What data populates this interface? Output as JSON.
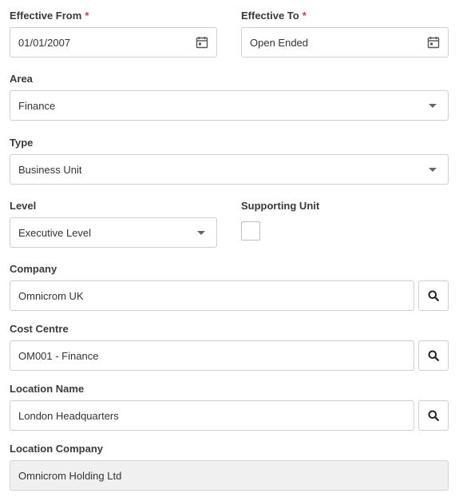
{
  "effective_from": {
    "label": "Effective From",
    "required_mark": "*",
    "value": "01/01/2007",
    "icon": "calendar-icon"
  },
  "effective_to": {
    "label": "Effective To",
    "required_mark": "*",
    "value": "Open Ended",
    "icon": "calendar-icon"
  },
  "area": {
    "label": "Area",
    "value": "Finance",
    "icon": "chevron-down-icon"
  },
  "type": {
    "label": "Type",
    "value": "Business Unit",
    "icon": "chevron-down-icon"
  },
  "level": {
    "label": "Level",
    "value": "Executive Level",
    "icon": "chevron-down-icon"
  },
  "supporting_unit": {
    "label": "Supporting Unit",
    "checked": false
  },
  "company": {
    "label": "Company",
    "value": "Omnicrom UK",
    "icon": "search-icon"
  },
  "cost_centre": {
    "label": "Cost Centre",
    "value": "OM001 - Finance",
    "icon": "search-icon"
  },
  "location_name": {
    "label": "Location Name",
    "value": "London Headquarters",
    "icon": "search-icon"
  },
  "location_company": {
    "label": "Location Company",
    "value": "Omnicrom Holding Ltd"
  },
  "colors": {
    "required": "#d9363e",
    "border": "#cfcfcf",
    "readonly_bg": "#f0f0f0",
    "label_text": "#3a3a3a",
    "icon": "#555555"
  }
}
